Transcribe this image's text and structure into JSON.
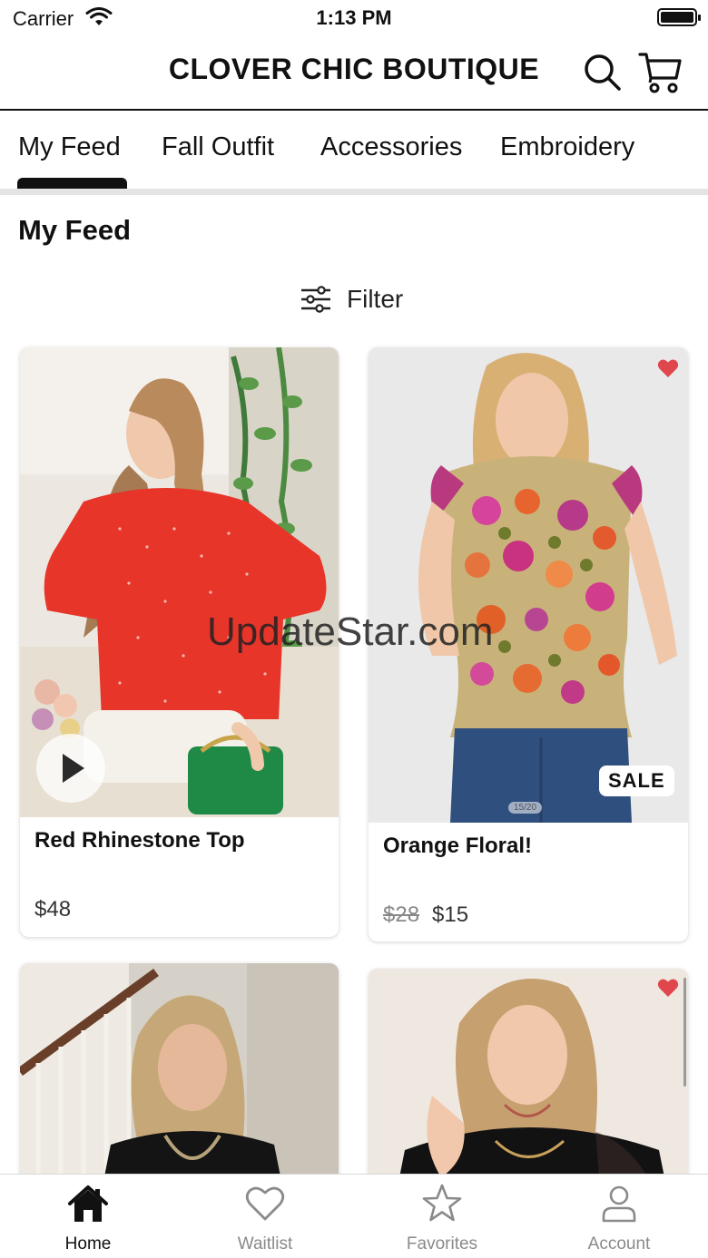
{
  "status_bar": {
    "carrier": "Carrier",
    "time": "1:13 PM"
  },
  "header": {
    "brand": "CLOVER CHIC BOUTIQUE"
  },
  "tabs": [
    {
      "label": "My Feed",
      "active": true
    },
    {
      "label": "Fall Outfit",
      "active": false
    },
    {
      "label": "Accessories",
      "active": false
    },
    {
      "label": "Embroidery",
      "active": false
    }
  ],
  "section": {
    "title": "My Feed"
  },
  "filter": {
    "label": "Filter"
  },
  "products": [
    {
      "title": "Red Rhinestone Top",
      "price": "$48",
      "has_video": true
    },
    {
      "title": "Orange Floral!",
      "original_price": "$28",
      "price": "$15",
      "badge": "SALE",
      "image_counter": "15/20",
      "favorited": true
    },
    {
      "title": "",
      "price": ""
    },
    {
      "title": "",
      "price": "",
      "favorited": true
    }
  ],
  "watermark": "UpdateStar.com",
  "bottom_nav": [
    {
      "label": "Home",
      "icon": "home-icon",
      "active": true
    },
    {
      "label": "Waitlist",
      "icon": "heart-icon",
      "active": false
    },
    {
      "label": "Favorites",
      "icon": "star-icon",
      "active": false
    },
    {
      "label": "Account",
      "icon": "person-icon",
      "active": false
    }
  ],
  "colors": {
    "accent": "#111111",
    "heart": "#e0474c",
    "muted": "#8a8a8a"
  }
}
